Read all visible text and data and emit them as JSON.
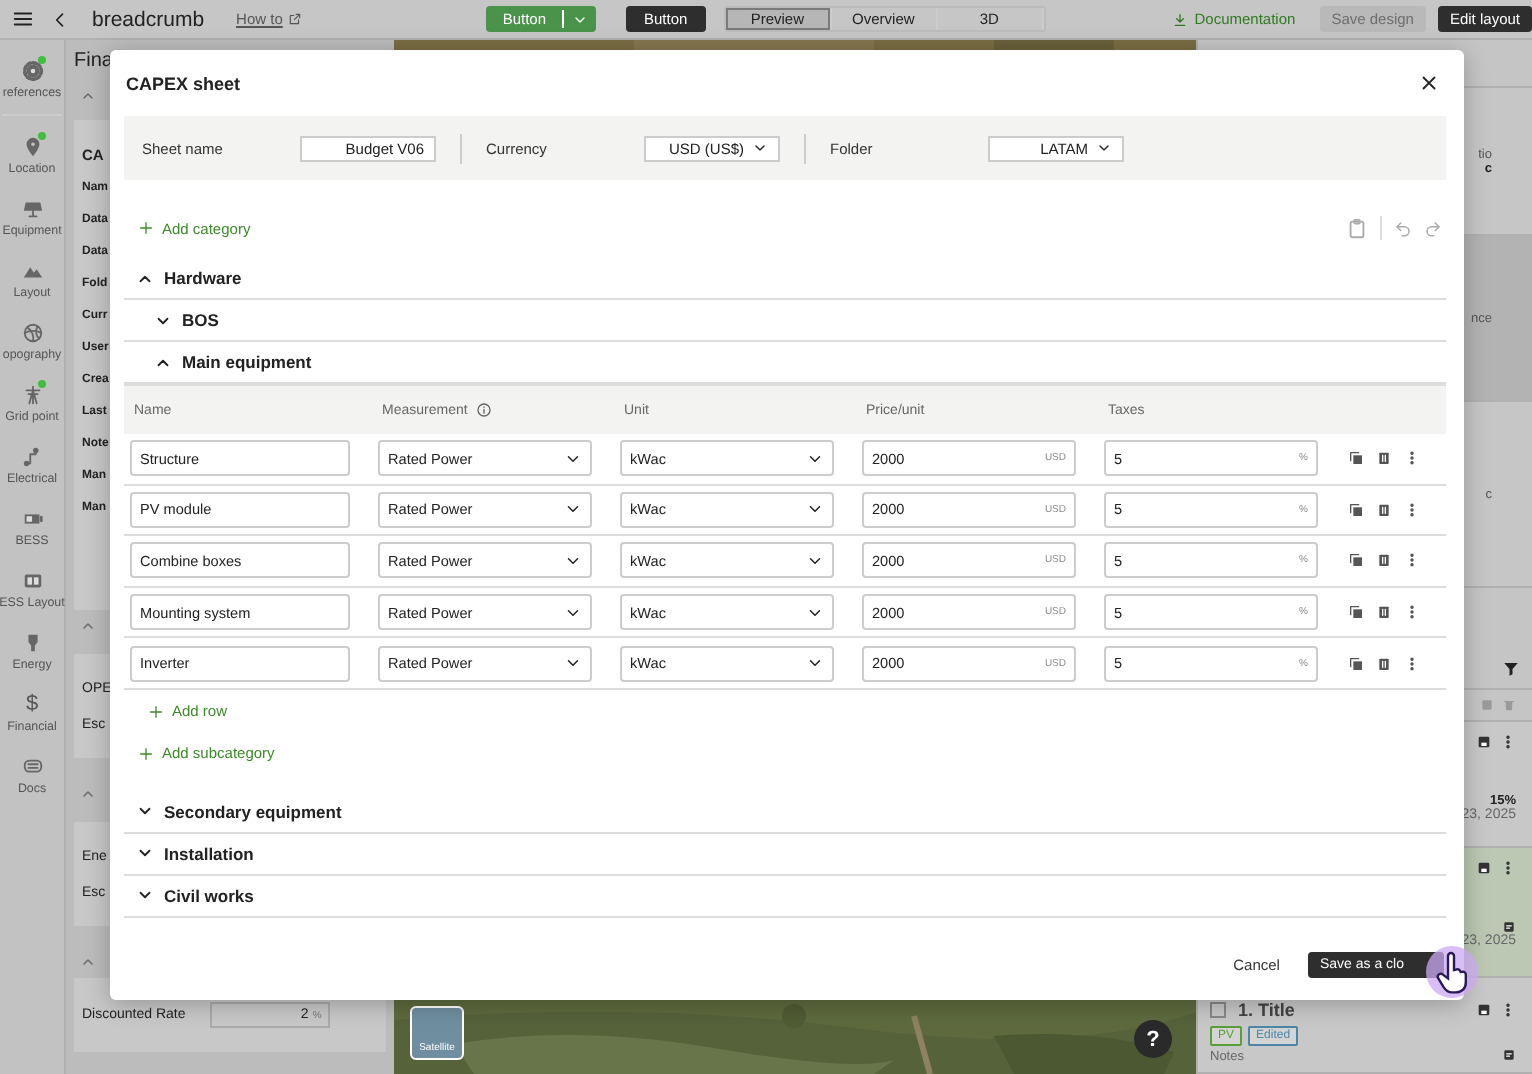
{
  "topbar": {
    "breadcrumb": "breadcrumb",
    "how_to": "How to",
    "primary_button": "Button",
    "secondary_button": "Button",
    "view_tabs": [
      {
        "label": "Preview",
        "selected": true
      },
      {
        "label": "Overview",
        "selected": false
      },
      {
        "label": "3D",
        "selected": false
      }
    ],
    "documentation": "Documentation",
    "save_design": {
      "label": "Save design",
      "disabled": true
    },
    "edit_layout": {
      "label": "Edit layout",
      "disabled": false
    }
  },
  "sidebar": {
    "items": [
      {
        "label": "references",
        "badge": true
      },
      {
        "label": "Location",
        "badge": true
      },
      {
        "label": "Equipment",
        "badge": false
      },
      {
        "label": "Layout",
        "badge": false
      },
      {
        "label": "opography",
        "badge": false
      },
      {
        "label": "Grid point",
        "badge": true
      },
      {
        "label": "Electrical",
        "badge": false
      },
      {
        "label": "BESS",
        "badge": false
      },
      {
        "label": "ESS Layout",
        "badge": false
      },
      {
        "label": "Energy",
        "badge": false
      },
      {
        "label": "Financial",
        "badge": false,
        "glyph": "$"
      },
      {
        "label": "Docs",
        "badge": false
      }
    ]
  },
  "left_panel": {
    "title": "Fina",
    "cards": [
      {
        "kind": "info",
        "title": "CA",
        "lines": [
          "Nam",
          "Data",
          "Data",
          "Fold",
          "Curr",
          "User",
          "Crea",
          "Last",
          "Note",
          "Man",
          "Man"
        ]
      },
      {
        "kind": "lines",
        "lines": [
          "OPE",
          "Esc"
        ]
      },
      {
        "kind": "lines",
        "lines": [
          "Ene",
          "Esc"
        ]
      },
      {
        "kind": "field",
        "label": "Discounted Rate",
        "value": "2",
        "unit": "%"
      }
    ]
  },
  "map": {
    "kind": "picture",
    "layer_label": "Satellite",
    "help": "?"
  },
  "right_panel": {
    "cards": [
      {
        "texts": [
          "tio",
          "c"
        ],
        "selected": false
      },
      {
        "texts": [
          "nce"
        ],
        "selected": true
      },
      {
        "texts": [
          "c"
        ],
        "selected": false
      }
    ],
    "items": [
      {
        "percent": "15%",
        "date": "23, 2025",
        "highlighted": false
      },
      {
        "date": "23, 2025",
        "highlighted": true
      },
      {
        "title": "1. Title",
        "checked": false,
        "highlighted": false,
        "tags": [
          {
            "label": "PV",
            "color": "#5a9e3a"
          },
          {
            "label": "Edited",
            "color": "#4a86a8"
          }
        ],
        "notes": "Notes"
      }
    ]
  },
  "dialog": {
    "title": "CAPEX sheet",
    "fields": [
      {
        "label": "Sheet name",
        "value": "Budget V06",
        "kind": "text"
      },
      {
        "label": "Currency",
        "value": "USD (US$)",
        "kind": "select"
      },
      {
        "label": "Folder",
        "value": "LATAM",
        "kind": "select"
      }
    ],
    "add_category": "Add category",
    "categories": [
      {
        "label": "Hardware",
        "expanded": true,
        "children": [
          {
            "label": "BOS",
            "expanded": false
          },
          {
            "label": "Main equipment",
            "expanded": true,
            "table": {
              "columns": [
                {
                  "label": "Name",
                  "info": false
                },
                {
                  "label": "Measurement",
                  "info": true
                },
                {
                  "label": "Unit",
                  "info": false
                },
                {
                  "label": "Price/unit",
                  "info": false
                },
                {
                  "label": "Taxes",
                  "info": false
                }
              ],
              "rows": [
                {
                  "name": "Structure",
                  "measurement": "Rated Power",
                  "unit": "kWac",
                  "price": "2000",
                  "currency": "USD",
                  "taxes": "5",
                  "tax_unit": "%"
                },
                {
                  "name": "PV module",
                  "measurement": "Rated Power",
                  "unit": "kWac",
                  "price": "2000",
                  "currency": "USD",
                  "taxes": "5",
                  "tax_unit": "%"
                },
                {
                  "name": "Combine boxes",
                  "measurement": "Rated Power",
                  "unit": "kWac",
                  "price": "2000",
                  "currency": "USD",
                  "taxes": "5",
                  "tax_unit": "%"
                },
                {
                  "name": "Mounting system",
                  "measurement": "Rated Power",
                  "unit": "kWac",
                  "price": "2000",
                  "currency": "USD",
                  "taxes": "5",
                  "tax_unit": "%"
                },
                {
                  "name": "Inverter",
                  "measurement": "Rated Power",
                  "unit": "kWac",
                  "price": "2000",
                  "currency": "USD",
                  "taxes": "5",
                  "tax_unit": "%"
                }
              ],
              "add_row": "Add row"
            }
          }
        ],
        "add_subcategory": "Add subcategory"
      },
      {
        "label": "Secondary equipment",
        "expanded": false
      },
      {
        "label": "Installation",
        "expanded": false
      },
      {
        "label": "Civil works",
        "expanded": false
      }
    ],
    "cancel": "Cancel",
    "save": "Save as a clo"
  }
}
